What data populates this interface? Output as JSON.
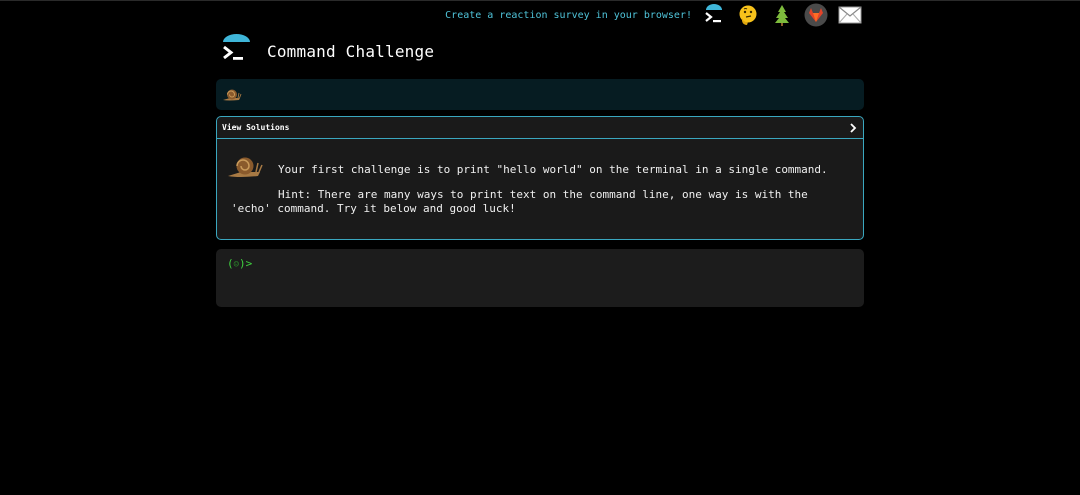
{
  "topbar": {
    "promo_text": "Create a reaction survey in your browser!",
    "icons": [
      "terminal-logo-icon",
      "thinking-emoji-icon",
      "tree-icon",
      "gitlab-icon",
      "envelope-icon"
    ]
  },
  "header": {
    "title": "Command Challenge"
  },
  "panel": {
    "header_label": "View Solutions",
    "challenge": "Your first challenge is to print \"hello world\" on the terminal in a single command.",
    "hint": "Hint: There are many ways to print text on the command line, one way is with the 'echo' command. Try it below and good luck!"
  },
  "terminal": {
    "prompt_open": "(",
    "prompt_face": "☺",
    "prompt_close": ")>"
  },
  "colors": {
    "accent": "#3aa7bf",
    "promo": "#4fc3d9",
    "prompt": "#3fd13f",
    "progress_bg": "#061c22"
  }
}
